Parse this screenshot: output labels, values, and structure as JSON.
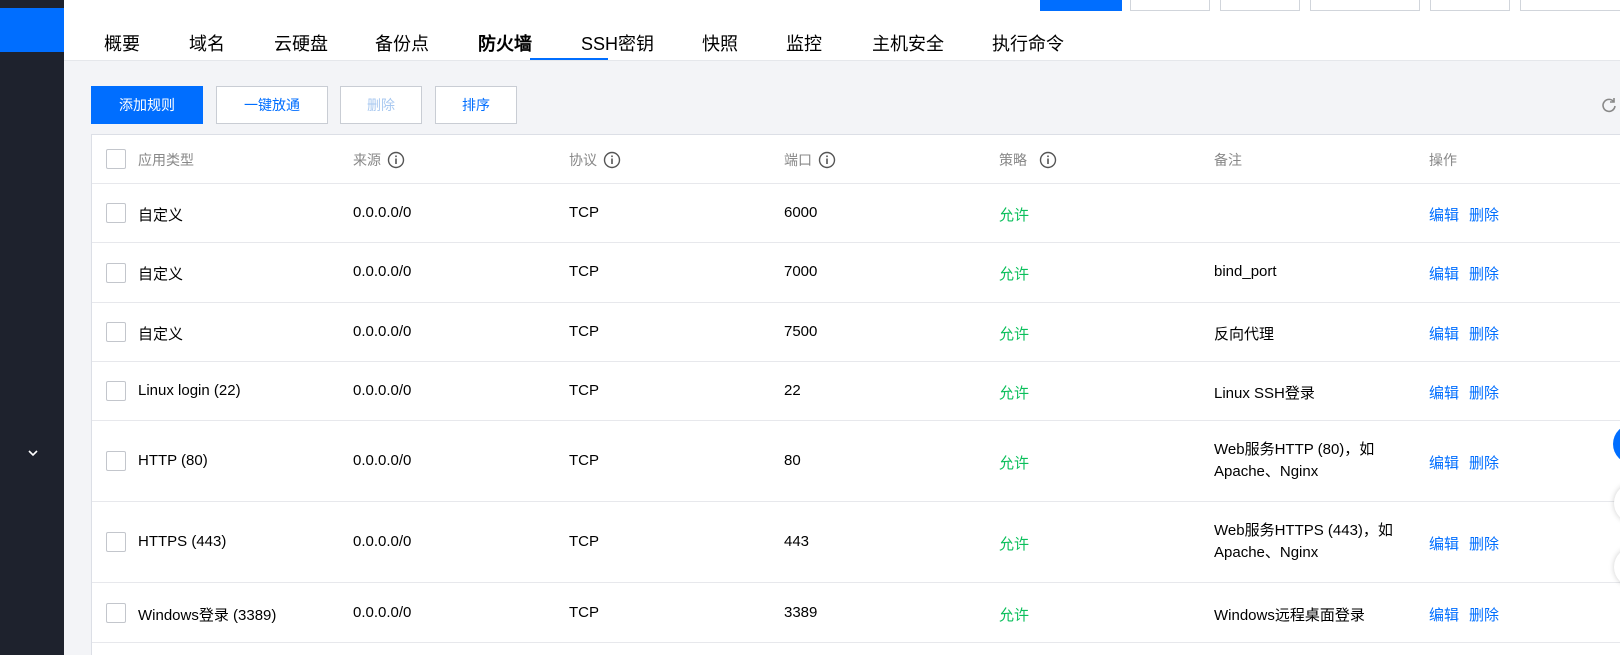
{
  "tabs": [
    "概要",
    "域名",
    "云硬盘",
    "备份点",
    "防火墙",
    "SSH密钥",
    "快照",
    "监控",
    "主机安全",
    "执行命令"
  ],
  "active_tab": "防火墙",
  "toolbar": {
    "add_rule": "添加规则",
    "one_click": "一键放通",
    "delete": "删除",
    "sort": "排序"
  },
  "table": {
    "headers": {
      "app_type": "应用类型",
      "source": "来源",
      "protocol": "协议",
      "port": "端口",
      "policy": "策略",
      "remark": "备注",
      "action": "操作"
    },
    "rows": [
      {
        "app_type": "自定义",
        "source": "0.0.0.0/0",
        "protocol": "TCP",
        "port": "6000",
        "policy": "允许",
        "remark": ""
      },
      {
        "app_type": "自定义",
        "source": "0.0.0.0/0",
        "protocol": "TCP",
        "port": "7000",
        "policy": "允许",
        "remark": "bind_port"
      },
      {
        "app_type": "自定义",
        "source": "0.0.0.0/0",
        "protocol": "TCP",
        "port": "7500",
        "policy": "允许",
        "remark": "反向代理"
      },
      {
        "app_type": "Linux login (22)",
        "source": "0.0.0.0/0",
        "protocol": "TCP",
        "port": "22",
        "policy": "允许",
        "remark": "Linux SSH登录"
      },
      {
        "app_type": "HTTP (80)",
        "source": "0.0.0.0/0",
        "protocol": "TCP",
        "port": "80",
        "policy": "允许",
        "remark": "Web服务HTTP (80)，如 Apache、Nginx"
      },
      {
        "app_type": "HTTPS (443)",
        "source": "0.0.0.0/0",
        "protocol": "TCP",
        "port": "443",
        "policy": "允许",
        "remark": "Web服务HTTPS (443)，如 Apache、Nginx"
      },
      {
        "app_type": "Windows登录 (3389)",
        "source": "0.0.0.0/0",
        "protocol": "TCP",
        "port": "3389",
        "policy": "允许",
        "remark": "Windows远程桌面登录"
      }
    ],
    "edit_label": "编辑",
    "delete_label": "删除"
  },
  "colors": {
    "accent": "#006eff",
    "allow": "#0abf5b",
    "sidebar": "#1e222d"
  }
}
